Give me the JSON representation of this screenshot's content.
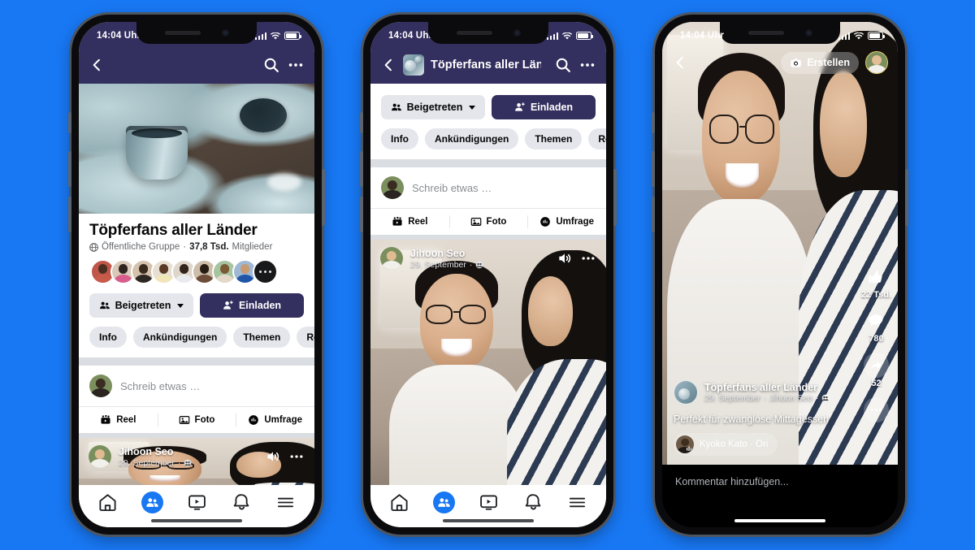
{
  "background_color": "#1877f2",
  "brand": {
    "fb_blue": "#1877f2",
    "header_navy": "#332f5e",
    "pill_grey": "#e4e6eb"
  },
  "status_bar": {
    "time": "14:04 Uhr",
    "signal_icon": "cellular-bars-icon",
    "wifi_icon": "wifi-icon",
    "battery_icon": "battery-icon"
  },
  "phone_1": {
    "name": "group-profile-screen",
    "header": {
      "back_icon": "chevron-left-icon",
      "search_icon": "search-icon",
      "more_icon": "more-horizontal-icon"
    },
    "cover_photo_alt": "pottery-cover-photo",
    "group": {
      "title": "Töpferfans aller Länder",
      "privacy_icon": "globe-icon",
      "privacy": "Öffentliche Gruppe",
      "separator": "·",
      "member_count": "37,8 Tsd.",
      "member_label": "Mitglieder",
      "avatar_count": 9,
      "avatar_overflow_icon": "more-dots-icon"
    },
    "actions": {
      "joined_icon": "people-icon",
      "joined_label": "Beigetreten",
      "joined_caret_icon": "chevron-down-icon",
      "invite_icon": "person-add-icon",
      "invite_label": "Einladen"
    },
    "tabs": [
      "Info",
      "Ankündigungen",
      "Themen",
      "Reels"
    ],
    "composer": {
      "avatar": "user-avatar",
      "placeholder": "Schreib etwas …",
      "actions": [
        {
          "icon": "reel-icon",
          "label": "Reel"
        },
        {
          "icon": "photo-icon",
          "label": "Foto"
        },
        {
          "icon": "poll-icon",
          "label": "Umfrage"
        }
      ]
    },
    "post": {
      "author": "Jihoon Seo",
      "date": "29. September",
      "separator": "·",
      "audience_icon": "group-privacy-icon",
      "sound_icon": "speaker-on-icon",
      "more_icon": "more-horizontal-icon"
    },
    "bottom_nav": [
      {
        "icon": "home-icon",
        "active": false
      },
      {
        "icon": "groups-icon",
        "active": true
      },
      {
        "icon": "watch-video-icon",
        "active": false
      },
      {
        "icon": "bell-notifications-icon",
        "active": false
      },
      {
        "icon": "menu-hamburger-icon",
        "active": false
      }
    ]
  },
  "phone_2": {
    "name": "group-feed-screen",
    "header": {
      "back_icon": "chevron-left-icon",
      "group_image": "group-thumbnail",
      "title": "Töpferfans aller Länder",
      "search_icon": "search-icon",
      "more_icon": "more-horizontal-icon"
    },
    "actions": {
      "joined_icon": "people-icon",
      "joined_label": "Beigetreten",
      "joined_caret_icon": "chevron-down-icon",
      "invite_icon": "person-add-icon",
      "invite_label": "Einladen"
    },
    "tabs": [
      "Info",
      "Ankündigungen",
      "Themen",
      "Reels"
    ],
    "composer": {
      "placeholder": "Schreib etwas …",
      "actions": [
        {
          "icon": "reel-icon",
          "label": "Reel"
        },
        {
          "icon": "photo-icon",
          "label": "Foto"
        },
        {
          "icon": "poll-icon",
          "label": "Umfrage"
        }
      ]
    },
    "post": {
      "author": "Jihoon Seo",
      "date": "29. September",
      "separator": "·",
      "audience_icon": "group-privacy-icon",
      "sound_icon": "speaker-on-icon",
      "more_icon": "more-horizontal-icon"
    },
    "bottom_nav": [
      {
        "icon": "home-icon",
        "active": false
      },
      {
        "icon": "groups-icon",
        "active": true
      },
      {
        "icon": "watch-video-icon",
        "active": false
      },
      {
        "icon": "bell-notifications-icon",
        "active": false
      },
      {
        "icon": "menu-hamburger-icon",
        "active": false
      }
    ]
  },
  "phone_3": {
    "name": "reel-player-screen",
    "top": {
      "back_icon": "chevron-left-icon",
      "create_icon": "camera-icon",
      "create_label": "Erstellen",
      "profile_avatar": "user-avatar"
    },
    "rail": [
      {
        "icon": "thumbs-up-icon",
        "count": "22 Tsd."
      },
      {
        "icon": "comment-bubble-icon",
        "count": "780"
      },
      {
        "icon": "share-arrow-icon",
        "count": "52"
      },
      {
        "icon": "more-dots-icon",
        "count": ""
      }
    ],
    "info": {
      "group_image": "group-thumbnail",
      "group_name": "Töpferfans aller Länder",
      "date": "29. September",
      "separator": "·",
      "author": "Jihoon Seo",
      "audience_icon": "group-privacy-icon",
      "caption": "Perfekt für zwanglose Mittagessen",
      "audio_icon": "audio-wave-icon",
      "audio_label": "Kyoko Kato · Ori"
    },
    "comment_placeholder": "Kommentar hinzufügen..."
  }
}
